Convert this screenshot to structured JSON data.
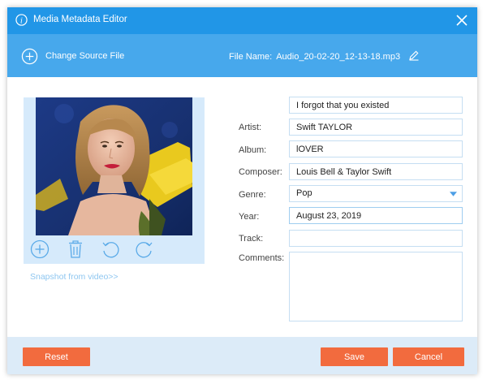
{
  "window": {
    "title": "Media Metadata Editor"
  },
  "toolbar": {
    "change_source_label": "Change Source File",
    "file_name_label": "File Name:",
    "file_name_value": "Audio_20-02-20_12-13-18.mp3"
  },
  "artwork": {
    "snapshot_link": "Snapshot from video>>"
  },
  "form": {
    "title_value": "I forgot that you existed",
    "artist_label": "Artist:",
    "artist_value": "Swift TAYLOR",
    "album_label": "Album:",
    "album_value": "lOVER",
    "composer_label": "Composer:",
    "composer_value": "Louis Bell & Taylor Swift",
    "genre_label": "Genre:",
    "genre_value": "Pop",
    "year_label": "Year:",
    "year_value": "August 23, 2019",
    "track_label": "Track:",
    "track_value": "",
    "comments_label": "Comments:",
    "comments_value": ""
  },
  "footer": {
    "reset_label": "Reset",
    "save_label": "Save",
    "cancel_label": "Cancel"
  },
  "colors": {
    "titlebar": "#2196e7",
    "toolbar": "#47a8ec",
    "accent_button": "#f26b3e",
    "footer": "#dcebf8"
  }
}
